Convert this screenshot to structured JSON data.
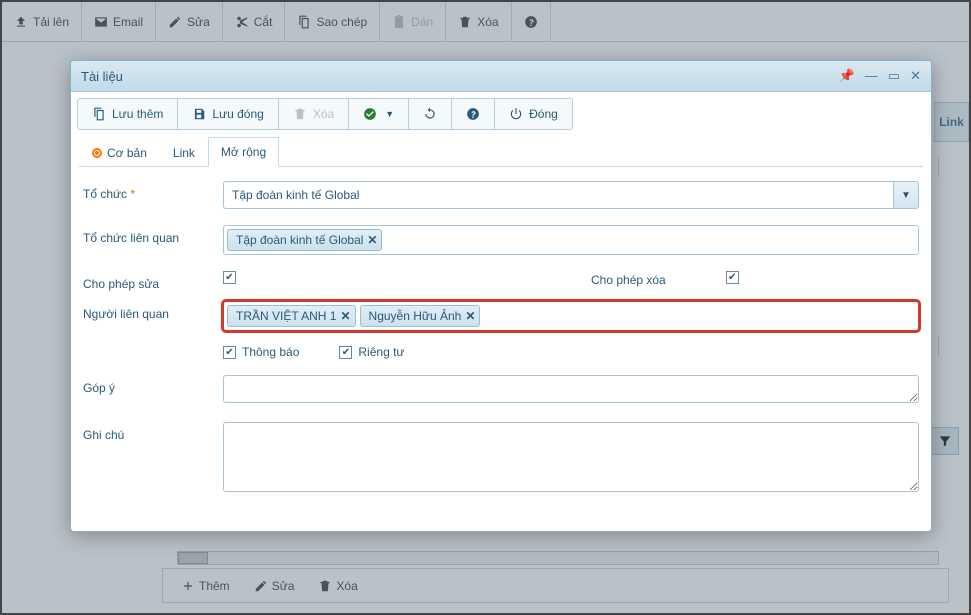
{
  "bg_toolbar": {
    "upload": "Tải lên",
    "email": "Email",
    "edit": "Sửa",
    "cut": "Cắt",
    "copy": "Sao chép",
    "paste": "Dán",
    "delete": "Xóa"
  },
  "bg_right_tab": "Link",
  "bg_bottom": {
    "add": "Thêm",
    "edit": "Sửa",
    "delete": "Xóa"
  },
  "modal": {
    "title": "Tài liệu",
    "toolbar": {
      "save_more": "Lưu thêm",
      "save_close": "Lưu đóng",
      "delete": "Xóa",
      "close": "Đóng"
    },
    "tabs": {
      "basic": "Cơ bản",
      "link": "Link",
      "extended": "Mở rộng"
    },
    "labels": {
      "org": "Tổ chức",
      "related_org": "Tổ chức liên quan",
      "allow_edit": "Cho phép sửa",
      "allow_delete": "Cho phép xóa",
      "related_people": "Người liên quan",
      "notify": "Thông báo",
      "private": "Riêng tư",
      "feedback": "Góp ý",
      "note": "Ghi chú"
    },
    "org_value": "Tập đoàn kinh tế Global",
    "related_org_tags": [
      "Tập đoàn kinh tế Global"
    ],
    "people_tags": [
      "TRẦN VIỆT ANH 1",
      "Nguyễn Hữu Ảnh"
    ],
    "allow_edit_checked": true,
    "allow_delete_checked": true,
    "notify_checked": true,
    "private_checked": true,
    "feedback_value": "",
    "note_value": ""
  }
}
